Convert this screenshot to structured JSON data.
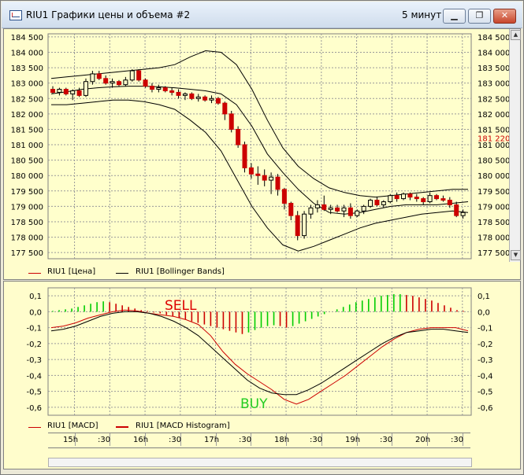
{
  "window": {
    "title": "RIU1 Графики цены и объема #2",
    "timeframe": "5 минут",
    "buttons": [
      "minimize",
      "maximize",
      "close"
    ]
  },
  "price_pane": {
    "legend": [
      {
        "label": "RIU1 [Цена]",
        "color": "#cc0000"
      },
      {
        "label": "RIU1 [Bollinger Bands]",
        "color": "#000000"
      }
    ],
    "current_price_label": "181 220",
    "current_price_color": "#cc0000"
  },
  "macd_pane": {
    "legend": [
      {
        "label": "RIU1 [MACD]",
        "color": "#cc0000"
      },
      {
        "label": "RIU1 [MACD Histogram]",
        "color": "#cc0000"
      }
    ],
    "annotations": [
      {
        "text": "SELL",
        "color": "#dd0000"
      },
      {
        "text": "BUY",
        "color": "#22cc22"
      }
    ]
  },
  "time_axis": [
    "15h",
    ":30",
    "16h",
    ":30",
    "17h",
    ":30",
    "18h",
    ":30",
    "19h",
    ":30",
    "20h",
    ":30"
  ],
  "chart_data": [
    {
      "type": "candlestick",
      "title": "RIU1 [Цена]",
      "y_ticks": [
        "184 500",
        "184 000",
        "183 500",
        "183 000",
        "182 500",
        "182 000",
        "181 500",
        "181 000",
        "180 500",
        "180 000",
        "179 500",
        "179 000",
        "178 500",
        "178 000",
        "177 500"
      ],
      "ylim": [
        177300,
        184600
      ],
      "grid": true,
      "series": [
        {
          "name": "RIU1 [Цена]",
          "color": "#cc0000",
          "candles": [
            [
              182800,
              182900,
              182650,
              182700
            ],
            [
              182700,
              182850,
              182600,
              182800
            ],
            [
              182800,
              182850,
              182600,
              182650
            ],
            [
              182650,
              182800,
              182450,
              182750
            ],
            [
              182750,
              182850,
              182550,
              182600
            ],
            [
              182600,
              183150,
              182550,
              183050
            ],
            [
              183050,
              183400,
              182950,
              183300
            ],
            [
              183300,
              183400,
              183100,
              183150
            ],
            [
              183150,
              183250,
              182950,
              183000
            ],
            [
              183000,
              183150,
              182850,
              183050
            ],
            [
              183050,
              183100,
              182900,
              182950
            ],
            [
              182950,
              183200,
              182900,
              183100
            ],
            [
              183100,
              183450,
              183050,
              183400
            ],
            [
              183400,
              183450,
              183050,
              183100
            ],
            [
              183100,
              183150,
              182850,
              182900
            ],
            [
              182900,
              183000,
              182700,
              182800
            ],
            [
              182800,
              182950,
              182700,
              182850
            ],
            [
              182850,
              182900,
              182700,
              182750
            ],
            [
              182750,
              182850,
              182600,
              182700
            ],
            [
              182700,
              182800,
              182500,
              182600
            ],
            [
              182600,
              182700,
              182450,
              182650
            ],
            [
              182650,
              182700,
              182450,
              182500
            ],
            [
              182500,
              182650,
              182400,
              182550
            ],
            [
              182550,
              182600,
              182400,
              182450
            ],
            [
              182450,
              182600,
              182350,
              182500
            ],
            [
              182500,
              182550,
              182300,
              182350
            ],
            [
              182350,
              182400,
              181800,
              182000
            ],
            [
              182000,
              182100,
              181400,
              181500
            ],
            [
              181500,
              181600,
              180900,
              181000
            ],
            [
              181000,
              181100,
              180100,
              180250
            ],
            [
              180250,
              180400,
              179900,
              180050
            ],
            [
              180050,
              180300,
              179700,
              180000
            ],
            [
              180000,
              180200,
              179650,
              179850
            ],
            [
              179850,
              180100,
              179400,
              179950
            ],
            [
              179950,
              180050,
              179350,
              179550
            ],
            [
              179550,
              179600,
              178900,
              179100
            ],
            [
              179100,
              179150,
              178550,
              178700
            ],
            [
              178700,
              178850,
              177900,
              178050
            ],
            [
              178050,
              178850,
              177950,
              178750
            ],
            [
              178750,
              179050,
              178600,
              178950
            ],
            [
              178950,
              179200,
              178800,
              179050
            ],
            [
              179050,
              179350,
              178850,
              178900
            ],
            [
              178900,
              179050,
              178750,
              178950
            ],
            [
              178950,
              179050,
              178800,
              178850
            ],
            [
              178850,
              179050,
              178650,
              178950
            ],
            [
              178950,
              179100,
              178600,
              178700
            ],
            [
              178700,
              178900,
              178650,
              178850
            ],
            [
              178850,
              179050,
              178750,
              179000
            ],
            [
              179000,
              179250,
              178950,
              179200
            ],
            [
              179200,
              179300,
              179000,
              179050
            ],
            [
              179050,
              179200,
              178950,
              179150
            ],
            [
              179150,
              179400,
              179100,
              179350
            ],
            [
              179350,
              179450,
              179150,
              179250
            ],
            [
              179250,
              179450,
              179200,
              179400
            ],
            [
              179400,
              179450,
              179200,
              179300
            ],
            [
              179300,
              179400,
              179150,
              179250
            ],
            [
              179250,
              179300,
              179050,
              179150
            ],
            [
              179150,
              179450,
              179100,
              179350
            ],
            [
              179350,
              179400,
              179200,
              179250
            ],
            [
              179250,
              179350,
              179150,
              179200
            ],
            [
              179200,
              179300,
              178950,
              179050
            ],
            [
              179050,
              179150,
              178650,
              178700
            ],
            [
              178700,
              178900,
              178600,
              178800
            ]
          ]
        },
        {
          "name": "RIU1 [Bollinger Bands] middle",
          "color": "#000000",
          "values": [
            182650,
            182720,
            182800,
            182850,
            182880,
            182900,
            182900,
            182880,
            182850,
            182800,
            182750,
            182650,
            182300,
            181600,
            180700,
            180100,
            179550,
            179100,
            178800,
            178750,
            178800,
            178900,
            179000,
            179050,
            179050,
            179050,
            179100,
            179150
          ]
        },
        {
          "name": "RIU1 [Bollinger Bands] upper",
          "color": "#000000",
          "values": [
            183150,
            183200,
            183250,
            183300,
            183350,
            183400,
            183450,
            183500,
            183600,
            183850,
            184050,
            184000,
            183600,
            182800,
            181800,
            180900,
            180300,
            179900,
            179600,
            179450,
            179350,
            179300,
            179350,
            179400,
            179450,
            179500,
            179550,
            179550
          ]
        },
        {
          "name": "RIU1 [Bollinger Bands] lower",
          "color": "#000000",
          "values": [
            182300,
            182300,
            182350,
            182400,
            182450,
            182450,
            182400,
            182300,
            182150,
            181800,
            181400,
            180800,
            179900,
            179000,
            178300,
            177750,
            177550,
            177700,
            177900,
            178100,
            178300,
            178450,
            178550,
            178650,
            178750,
            178800,
            178850,
            178800
          ]
        }
      ]
    },
    {
      "type": "bar",
      "title": "RIU1 [MACD Histogram]",
      "y_ticks": [
        "0,1",
        "0,0",
        "-0,1",
        "-0,2",
        "-0,3",
        "-0,4",
        "-0,5",
        "-0,6"
      ],
      "ylim": [
        -0.65,
        0.15
      ],
      "grid": true,
      "series": [
        {
          "name": "RIU1 [MACD Histogram]",
          "colors": {
            "rising": "#00cc00",
            "falling": "#cc0000"
          },
          "values": [
            0.005,
            0.01,
            0.015,
            0.02,
            0.03,
            0.04,
            0.05,
            0.06,
            0.065,
            0.06,
            0.05,
            0.04,
            0.03,
            0.02,
            0.01,
            0.005,
            -0.005,
            -0.01,
            -0.02,
            -0.03,
            -0.04,
            -0.05,
            -0.06,
            -0.07,
            -0.08,
            -0.09,
            -0.1,
            -0.11,
            -0.12,
            -0.13,
            -0.14,
            -0.13,
            -0.115,
            -0.1,
            -0.09,
            -0.085,
            -0.09,
            -0.1,
            -0.09,
            -0.075,
            -0.06,
            -0.045,
            -0.03,
            -0.015,
            0.0,
            0.015,
            0.03,
            0.045,
            0.06,
            0.07,
            0.08,
            0.09,
            0.1,
            0.105,
            0.11,
            0.11,
            0.105,
            0.1,
            0.09,
            0.08,
            0.07,
            0.055,
            0.04,
            0.025,
            0.01,
            0.005
          ]
        }
      ]
    },
    {
      "type": "line",
      "title": "RIU1 [MACD]",
      "ylim": [
        -0.65,
        0.15
      ],
      "series": [
        {
          "name": "RIU1 [MACD]",
          "color": "#cc0000",
          "values": [
            -0.1,
            -0.09,
            -0.07,
            -0.04,
            -0.02,
            0.0,
            0.01,
            0.005,
            -0.01,
            -0.02,
            -0.03,
            -0.05,
            -0.08,
            -0.15,
            -0.25,
            -0.33,
            -0.39,
            -0.44,
            -0.49,
            -0.55,
            -0.58,
            -0.55,
            -0.5,
            -0.45,
            -0.4,
            -0.34,
            -0.28,
            -0.22,
            -0.17,
            -0.13,
            -0.11,
            -0.1,
            -0.1,
            -0.1,
            -0.12
          ]
        },
        {
          "name": "MACD signal",
          "color": "#000000",
          "values": [
            -0.12,
            -0.11,
            -0.09,
            -0.06,
            -0.03,
            -0.01,
            0.0,
            0.0,
            -0.01,
            -0.03,
            -0.06,
            -0.1,
            -0.15,
            -0.22,
            -0.29,
            -0.36,
            -0.43,
            -0.48,
            -0.51,
            -0.52,
            -0.52,
            -0.49,
            -0.45,
            -0.4,
            -0.35,
            -0.3,
            -0.25,
            -0.2,
            -0.16,
            -0.13,
            -0.12,
            -0.11,
            -0.11,
            -0.12,
            -0.13
          ]
        }
      ]
    }
  ]
}
